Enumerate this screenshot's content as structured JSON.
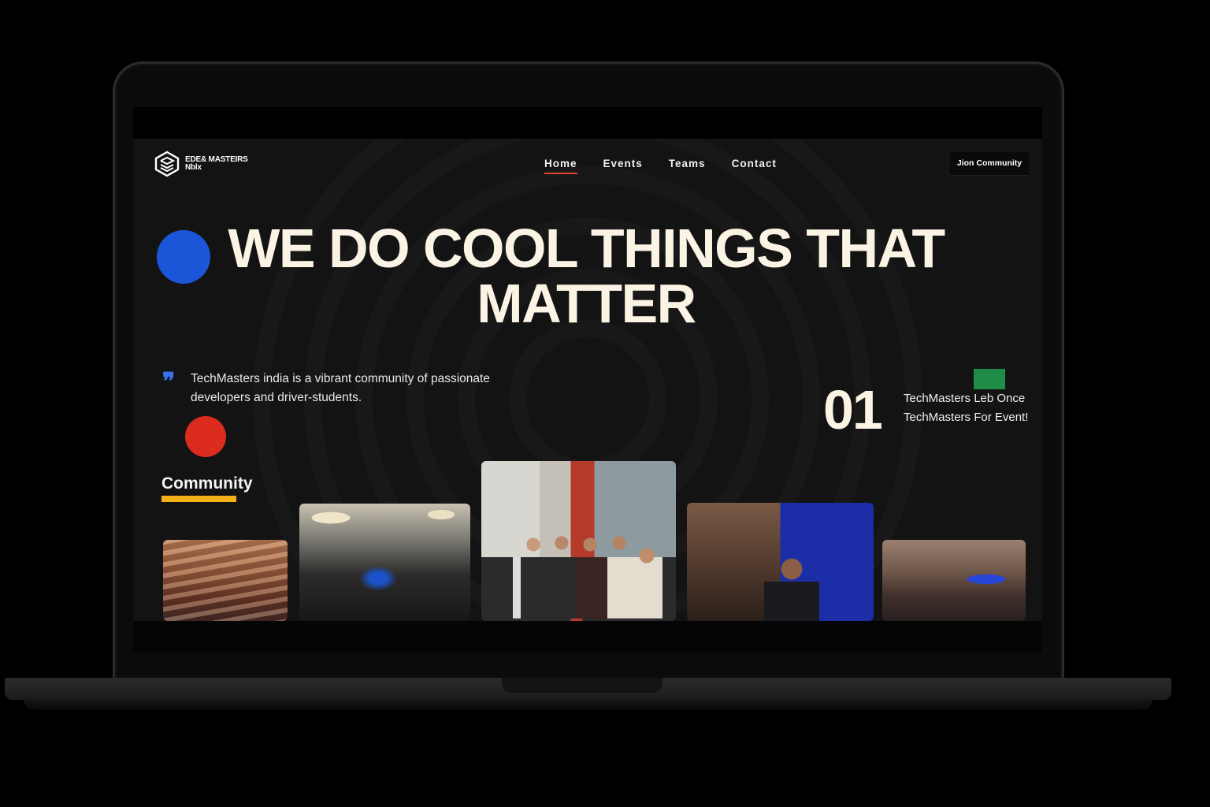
{
  "header": {
    "logo_text": "EDE& MASTEIRS\nNblx",
    "nav": [
      {
        "label": "Home",
        "active": true
      },
      {
        "label": "Events",
        "active": false
      },
      {
        "label": "Teams",
        "active": false
      },
      {
        "label": "Contact",
        "active": false
      }
    ],
    "cta_label": "Jion Community"
  },
  "hero": {
    "headline": "WE DO COOL THINGS THAT MATTER",
    "intro": "TechMasters india is a vibrant community of passionate developers and driver-students.",
    "stat_number": "01",
    "stat_text": "TechMasters Leb Once TechMasters For Event!"
  },
  "community": {
    "title": "Community",
    "photos": [
      "event-hall-photo",
      "audience-room-photo",
      "group-award-photo",
      "speaker-stage-photo",
      "crowd-photo"
    ]
  },
  "colors": {
    "accent_blue": "#1b56d8",
    "accent_red": "#dc2b1f",
    "accent_green": "#1f8d47",
    "accent_yellow": "#f2b117",
    "nav_underline": "#e2452e",
    "headline": "#fbf3e4",
    "background": "#131313"
  },
  "icons": {
    "logo": "hexagon-stack-icon",
    "quote": "quote-icon"
  }
}
